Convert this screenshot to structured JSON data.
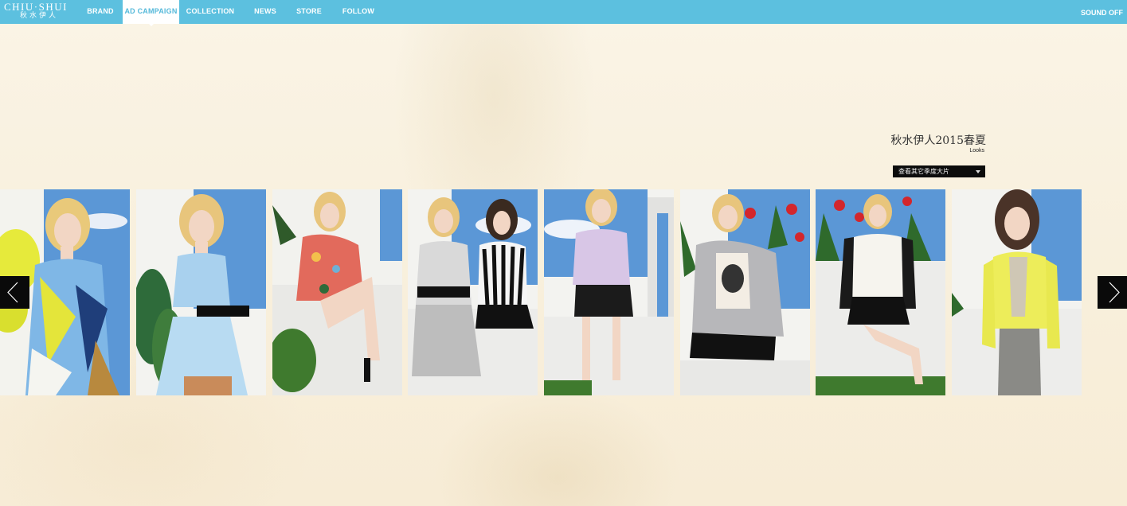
{
  "brand": {
    "name_en": "CHIU·SHUI",
    "name_cn": "秋水伊人"
  },
  "nav": {
    "items": [
      {
        "label": "BRAND",
        "active": false
      },
      {
        "label": "AD CAMPAIGN",
        "active": true
      },
      {
        "label": "COLLECTION",
        "active": false
      },
      {
        "label": "NEWS",
        "active": false
      },
      {
        "label": "STORE",
        "active": false
      },
      {
        "label": "FOLLOW",
        "active": false
      }
    ],
    "sound_label": "SOUND OFF"
  },
  "season": {
    "title": "秋水伊人2015春夏",
    "subtitle": "Looks",
    "select_label": "查看其它季度大片"
  },
  "gallery": {
    "looks": [
      {
        "outfit": "abstract print dress in yellow and blue"
      },
      {
        "outfit": "light blue printed dress with black belt"
      },
      {
        "outfit": "floral coral print top and skirt"
      },
      {
        "outfit": "black and white knit set, striped top"
      },
      {
        "outfit": "lilac sheer top with black skirt"
      },
      {
        "outfit": "grey checked jacket over graphic tee"
      },
      {
        "outfit": "white vest with black sheer sleeves"
      },
      {
        "outfit": "yellow blazer with knit top"
      }
    ],
    "prev_icon": "chevron-left-icon",
    "next_icon": "chevron-right-icon"
  },
  "colors": {
    "nav_bar": "#5cc0df",
    "page_bg": "#f9f1df",
    "sky": "#4f8fd3",
    "dark_button": "#0a0a0a"
  }
}
